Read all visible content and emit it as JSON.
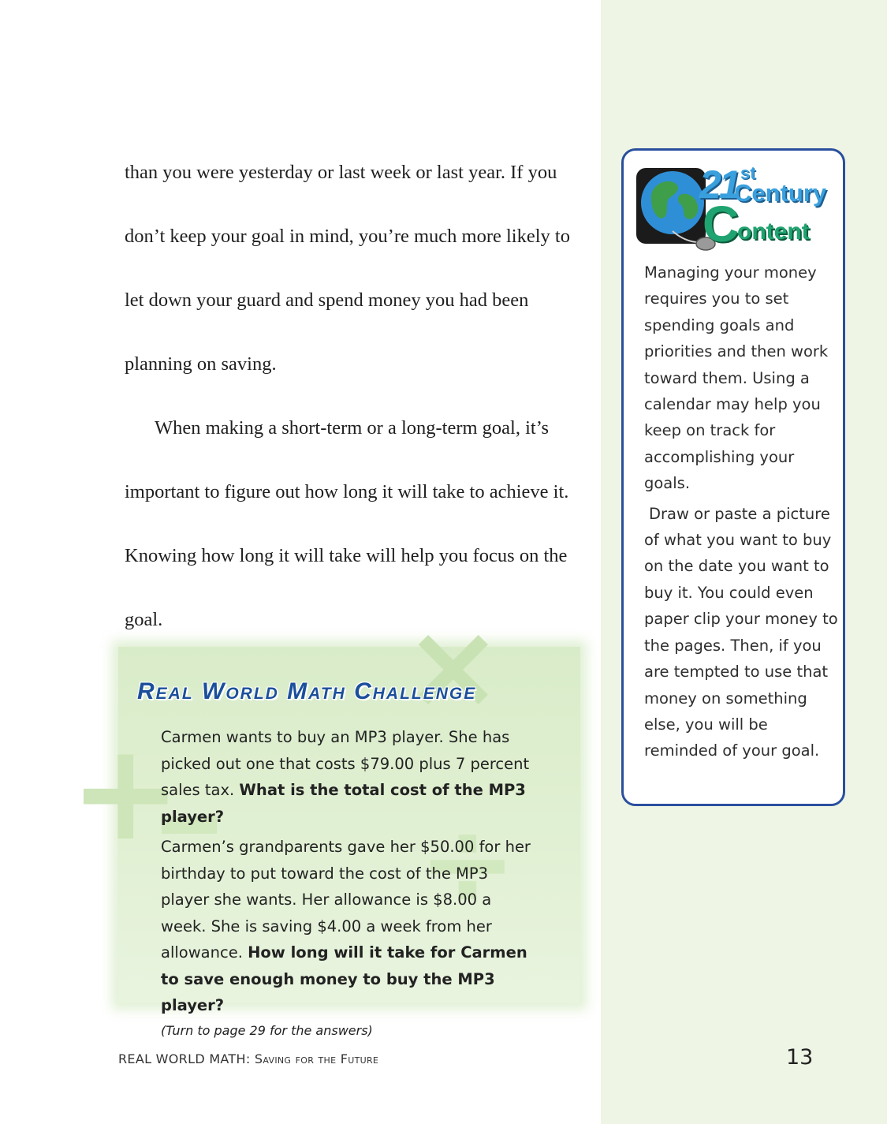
{
  "main_text": {
    "paragraph1": "than you were yesterday or last week or last year. If you don’t keep your goal in mind, you’re much more likely to let down your guard and spend money you had been planning on saving.",
    "paragraph2": "When making a short-term or a long-term goal, it’s important to figure out how long it will take to achieve it. Knowing how long it will take will help you focus on the goal."
  },
  "challenge": {
    "title": "Real World Math Challenge",
    "p1_text": "Carmen wants to buy an MP3 player. She has picked out one that costs $79.00 plus 7 percent sales tax.",
    "p1_question": "What is the total cost of the MP3 player?",
    "p2_text": "Carmen’s grandparents gave her $50.00 for her birthday to put toward the cost of the MP3 player she wants. Her allowance is $8.00 a week. She is saving $4.00 a week from her allowance.",
    "p2_question": "How long will it take for Carmen to save enough money to buy the MP3 player?",
    "note": "(Turn to page 29 for the answers)",
    "decorations": {
      "times": "×",
      "plus": "+",
      "divide": "÷"
    }
  },
  "sidebar": {
    "logo": {
      "number": "21",
      "suffix": "st",
      "word1": "Century",
      "c_letter": "C",
      "word2_rest": "ontent"
    },
    "paragraph1": "Managing your money requires you to set spending goals and priorities and then work toward them. Using a calendar may help you keep on track for accomplishing your goals.",
    "paragraph2": "Draw or paste a picture of what you want to buy on the date you want to buy it. You could even paper clip your money to the pages. Then, if you are tempted to use that money on something else, you will be reminded of your goal."
  },
  "footer": {
    "series": "REAL WORLD MATH:",
    "book_title": "Saving for the Future",
    "page_number": "13"
  },
  "colors": {
    "sidebar_bg": "#eef5e4",
    "card_border": "#2a4f9e",
    "challenge_title": "#1b4f9b",
    "challenge_bg": "#dcedcd",
    "logo_blue": "#3aa0dd",
    "logo_green": "#1fa370"
  }
}
